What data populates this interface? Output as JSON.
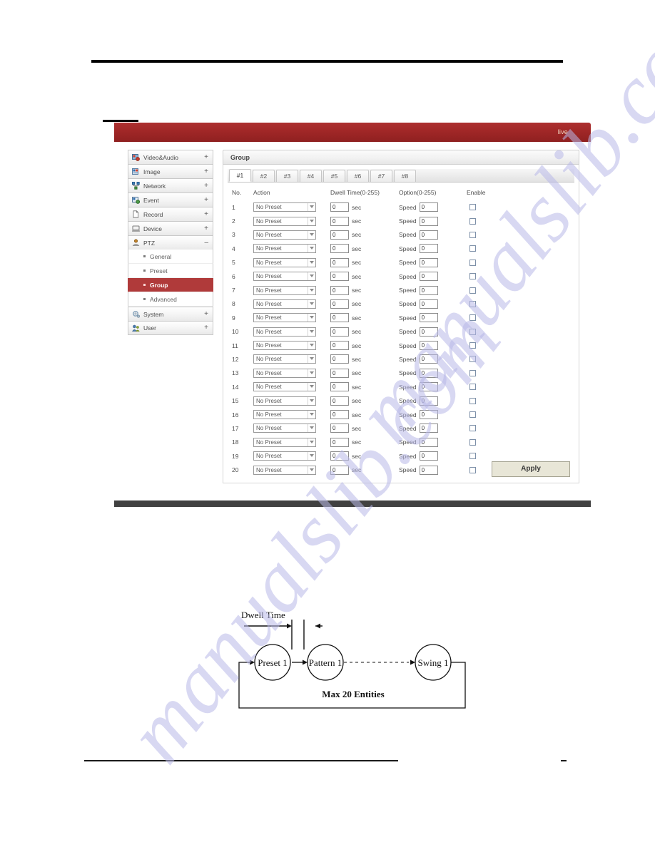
{
  "window": {
    "live_label": "live"
  },
  "sidebar": {
    "items": [
      {
        "label": "Video&Audio",
        "toggle": "+",
        "icon": "video-audio-icon"
      },
      {
        "label": "Image",
        "toggle": "+",
        "icon": "image-icon"
      },
      {
        "label": "Network",
        "toggle": "+",
        "icon": "network-icon"
      },
      {
        "label": "Event",
        "toggle": "+",
        "icon": "event-icon"
      },
      {
        "label": "Record",
        "toggle": "+",
        "icon": "record-icon"
      },
      {
        "label": "Device",
        "toggle": "+",
        "icon": "device-icon"
      },
      {
        "label": "PTZ",
        "toggle": "–",
        "icon": "ptz-icon"
      }
    ],
    "ptz_children": [
      {
        "label": "General",
        "active": false
      },
      {
        "label": "Preset",
        "active": false
      },
      {
        "label": "Group",
        "active": true
      },
      {
        "label": "Advanced",
        "active": false
      }
    ],
    "items_after": [
      {
        "label": "System",
        "toggle": "+",
        "icon": "system-icon"
      },
      {
        "label": "User",
        "toggle": "+",
        "icon": "user-icon"
      }
    ],
    "active_color": "#b03a3a"
  },
  "panel": {
    "title": "Group",
    "tabs": [
      {
        "label": "#1",
        "selected": true
      },
      {
        "label": "#2",
        "selected": false
      },
      {
        "label": "#3",
        "selected": false
      },
      {
        "label": "#4",
        "selected": false
      },
      {
        "label": "#5",
        "selected": false
      },
      {
        "label": "#6",
        "selected": false
      },
      {
        "label": "#7",
        "selected": false
      },
      {
        "label": "#8",
        "selected": false
      }
    ],
    "columns": {
      "no": "No.",
      "action": "Action",
      "dwell": "Dwell Time(0-255)",
      "option": "Option(0-255)",
      "enable": "Enable"
    },
    "unit_label": "sec",
    "option_label": "Speed",
    "apply_label": "Apply",
    "rows": [
      {
        "no": "1",
        "action": "No Preset",
        "dwell": "0",
        "option": "0",
        "enabled": false
      },
      {
        "no": "2",
        "action": "No Preset",
        "dwell": "0",
        "option": "0",
        "enabled": false
      },
      {
        "no": "3",
        "action": "No Preset",
        "dwell": "0",
        "option": "0",
        "enabled": false
      },
      {
        "no": "4",
        "action": "No Preset",
        "dwell": "0",
        "option": "0",
        "enabled": false
      },
      {
        "no": "5",
        "action": "No Preset",
        "dwell": "0",
        "option": "0",
        "enabled": false
      },
      {
        "no": "6",
        "action": "No Preset",
        "dwell": "0",
        "option": "0",
        "enabled": false
      },
      {
        "no": "7",
        "action": "No Preset",
        "dwell": "0",
        "option": "0",
        "enabled": false
      },
      {
        "no": "8",
        "action": "No Preset",
        "dwell": "0",
        "option": "0",
        "enabled": false
      },
      {
        "no": "9",
        "action": "No Preset",
        "dwell": "0",
        "option": "0",
        "enabled": false
      },
      {
        "no": "10",
        "action": "No Preset",
        "dwell": "0",
        "option": "0",
        "enabled": false
      },
      {
        "no": "11",
        "action": "No Preset",
        "dwell": "0",
        "option": "0",
        "enabled": false
      },
      {
        "no": "12",
        "action": "No Preset",
        "dwell": "0",
        "option": "0",
        "enabled": false
      },
      {
        "no": "13",
        "action": "No Preset",
        "dwell": "0",
        "option": "0",
        "enabled": false
      },
      {
        "no": "14",
        "action": "No Preset",
        "dwell": "0",
        "option": "0",
        "enabled": false
      },
      {
        "no": "15",
        "action": "No Preset",
        "dwell": "0",
        "option": "0",
        "enabled": false
      },
      {
        "no": "16",
        "action": "No Preset",
        "dwell": "0",
        "option": "0",
        "enabled": false
      },
      {
        "no": "17",
        "action": "No Preset",
        "dwell": "0",
        "option": "0",
        "enabled": false
      },
      {
        "no": "18",
        "action": "No Preset",
        "dwell": "0",
        "option": "0",
        "enabled": false
      },
      {
        "no": "19",
        "action": "No Preset",
        "dwell": "0",
        "option": "0",
        "enabled": false
      },
      {
        "no": "20",
        "action": "No Preset",
        "dwell": "0",
        "option": "0",
        "enabled": false
      }
    ]
  },
  "diagram": {
    "dwell_label": "Dwell Time",
    "nodes": [
      "Preset 1",
      "Pattern 1",
      "Swing 1"
    ],
    "caption": "Max 20 Entities"
  },
  "watermark": {
    "line1": "manualslib.com",
    "line2": "manualslib.com"
  }
}
